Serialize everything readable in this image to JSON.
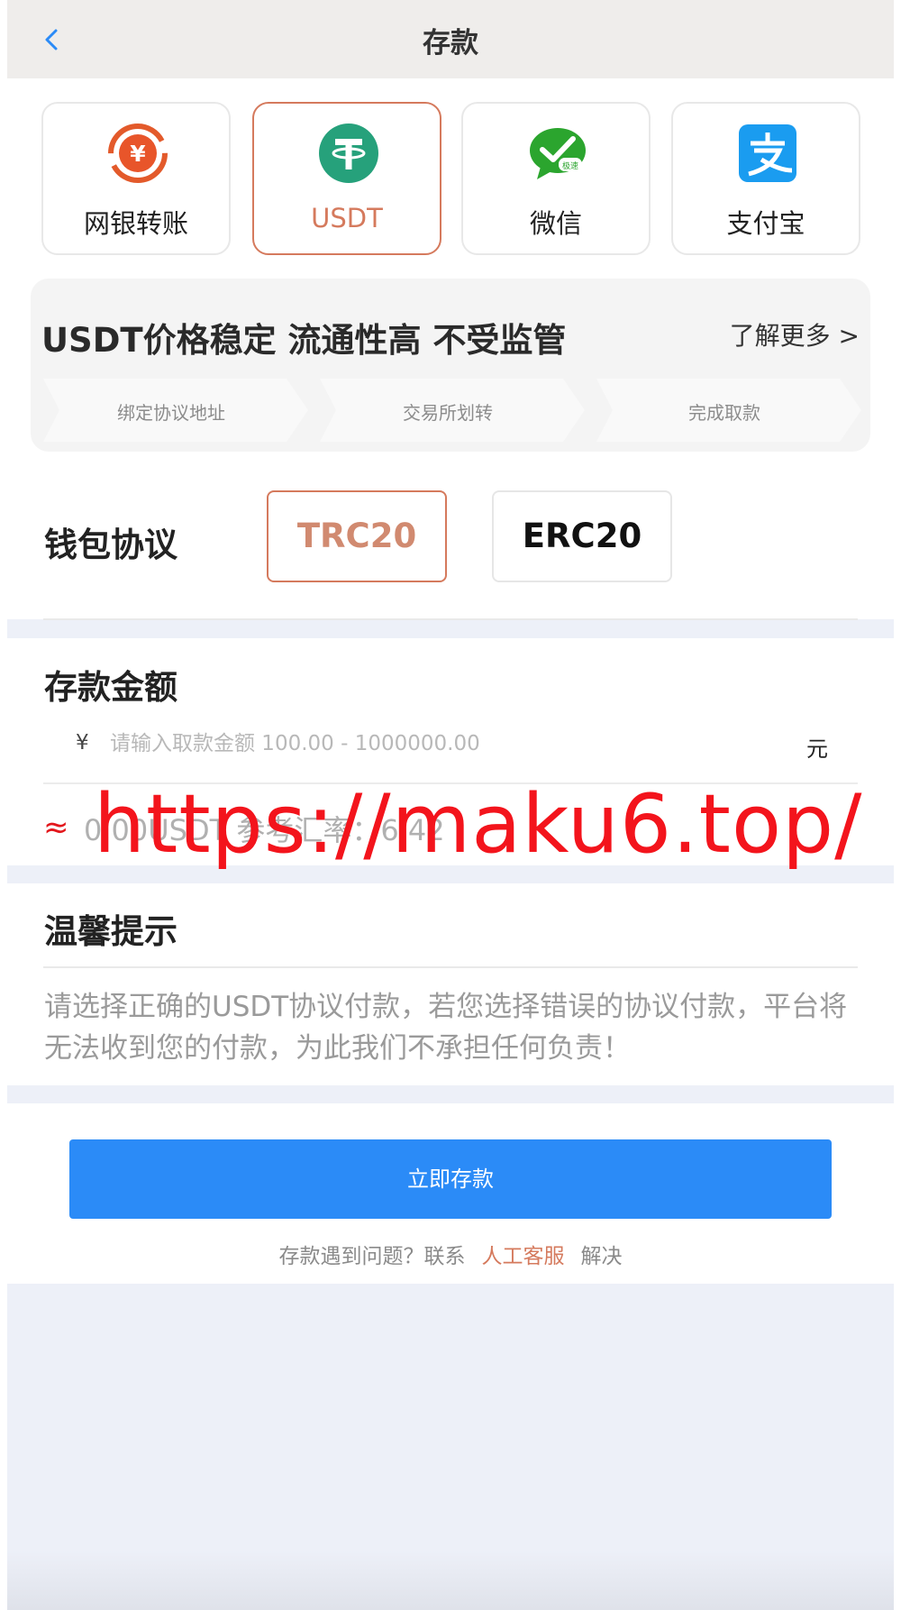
{
  "header": {
    "title": "存款",
    "back_icon": "chevron-left-icon"
  },
  "methods": [
    {
      "label": "网银转账",
      "icon": "bank-transfer-icon",
      "active": false
    },
    {
      "label": "USDT",
      "icon": "tether-icon",
      "active": true
    },
    {
      "label": "微信",
      "icon": "wechat-icon",
      "active": false
    },
    {
      "label": "支付宝",
      "icon": "alipay-icon",
      "active": false
    }
  ],
  "promo": {
    "title": "USDT价格稳定 流通性高 不受监管",
    "more": "了解更多 >",
    "steps": [
      "绑定协议地址",
      "交易所划转",
      "完成取款"
    ]
  },
  "protocol": {
    "label": "钱包协议",
    "options": [
      "TRC20",
      "ERC20"
    ],
    "selected": "TRC20"
  },
  "amount": {
    "title": "存款金额",
    "currency_symbol": "¥",
    "placeholder": "请输入取款金额 100.00 - 1000000.00",
    "value": "",
    "unit": "元",
    "approx_symbol": "≈",
    "conversion": "0.00USDT 参考汇率：6.42"
  },
  "watermark": "https://maku6.top/",
  "tips": {
    "title": "温馨提示",
    "text": "请选择正确的USDT协议付款，若您选择错误的协议付款，平台将无法收到您的付款，为此我们不承担任何负责！"
  },
  "action": {
    "deposit_label": "立即存款",
    "help_prefix": "存款遇到问题？联系",
    "help_link": "人工客服",
    "help_suffix": "解决"
  },
  "colors": {
    "accent": "#d57a5d",
    "primary_button": "#2b8bf7",
    "header_bg": "#efedeb",
    "watermark": "#f3141c"
  }
}
